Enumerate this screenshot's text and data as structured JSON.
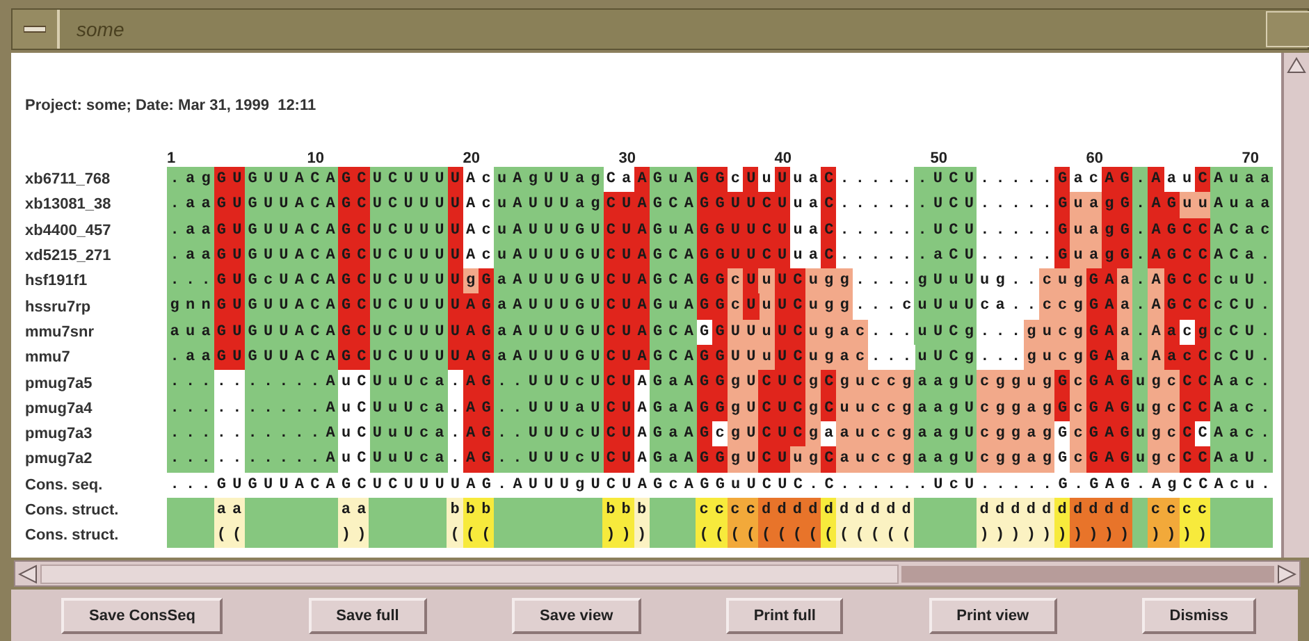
{
  "window": {
    "title": "some"
  },
  "header": "Project: some; Date: Mar 31, 1999  12:11",
  "ruler": [
    "1",
    "10",
    "20",
    "30",
    "40",
    "50",
    "60",
    "70"
  ],
  "rows": [
    {
      "name": "xb6711_768",
      "runs": [
        {
          "text": ".ag",
          "color": "#86c77f"
        },
        {
          "text": "GU",
          "color": "#e0251c"
        },
        {
          "text": "GUUACA",
          "color": "#86c77f"
        },
        {
          "text": "GC",
          "color": "#e0251c"
        },
        {
          "text": "UCUUU",
          "color": "#86c77f"
        },
        {
          "text": "U",
          "color": "#e0251c"
        },
        {
          "text": "Ac",
          "color": "#ffffff"
        },
        {
          "text": "uAgUUag",
          "color": "#86c77f"
        },
        {
          "text": "Ca",
          "color": "#ffffff"
        },
        {
          "text": "A",
          "color": "#e0251c"
        },
        {
          "text": "GuA",
          "color": "#86c77f"
        },
        {
          "text": "GG",
          "color": "#e0251c"
        },
        {
          "text": "c",
          "color": "#ffffff"
        },
        {
          "text": "U",
          "color": "#e0251c"
        },
        {
          "text": "u",
          "color": "#ffffff"
        },
        {
          "text": "U",
          "color": "#e0251c"
        },
        {
          "text": "ua",
          "color": "#ffffff"
        },
        {
          "text": "C",
          "color": "#e0251c"
        },
        {
          "text": ".....",
          "color": "#ffffff"
        },
        {
          "text": ".UCU",
          "color": "#86c77f"
        },
        {
          "text": ".....",
          "color": "#ffffff"
        },
        {
          "text": "G",
          "color": "#e0251c"
        },
        {
          "text": "ac",
          "color": "#ffffff"
        },
        {
          "text": "AG",
          "color": "#e0251c"
        },
        {
          "text": ".",
          "color": "#86c77f"
        },
        {
          "text": "A",
          "color": "#e0251c"
        },
        {
          "text": "au",
          "color": "#ffffff"
        },
        {
          "text": "C",
          "color": "#e0251c"
        },
        {
          "text": "Auaa",
          "color": "#86c77f"
        }
      ]
    },
    {
      "name": "xb13081_38",
      "runs": [
        {
          "text": ".aa",
          "color": "#86c77f"
        },
        {
          "text": "GU",
          "color": "#e0251c"
        },
        {
          "text": "GUUACA",
          "color": "#86c77f"
        },
        {
          "text": "GC",
          "color": "#e0251c"
        },
        {
          "text": "UCUUU",
          "color": "#86c77f"
        },
        {
          "text": "U",
          "color": "#e0251c"
        },
        {
          "text": "Ac",
          "color": "#ffffff"
        },
        {
          "text": "uAUUUag",
          "color": "#86c77f"
        },
        {
          "text": "CUA",
          "color": "#e0251c"
        },
        {
          "text": "GCA",
          "color": "#86c77f"
        },
        {
          "text": "GGUUCU",
          "color": "#e0251c"
        },
        {
          "text": "ua",
          "color": "#ffffff"
        },
        {
          "text": "C",
          "color": "#e0251c"
        },
        {
          "text": ".....",
          "color": "#ffffff"
        },
        {
          "text": ".UCU",
          "color": "#86c77f"
        },
        {
          "text": ".....",
          "color": "#ffffff"
        },
        {
          "text": "G",
          "color": "#e0251c"
        },
        {
          "text": "ua",
          "color": "#f2a98a"
        },
        {
          "text": "gG",
          "color": "#e0251c"
        },
        {
          "text": ".",
          "color": "#86c77f"
        },
        {
          "text": "AG",
          "color": "#e0251c"
        },
        {
          "text": "uu",
          "color": "#f2a98a"
        },
        {
          "text": "Auaa",
          "color": "#86c77f"
        }
      ]
    },
    {
      "name": "xb4400_457",
      "runs": [
        {
          "text": ".aa",
          "color": "#86c77f"
        },
        {
          "text": "GU",
          "color": "#e0251c"
        },
        {
          "text": "GUUACA",
          "color": "#86c77f"
        },
        {
          "text": "GC",
          "color": "#e0251c"
        },
        {
          "text": "UCUUU",
          "color": "#86c77f"
        },
        {
          "text": "U",
          "color": "#e0251c"
        },
        {
          "text": "Ac",
          "color": "#ffffff"
        },
        {
          "text": "uAUUUGU",
          "color": "#86c77f"
        },
        {
          "text": "CUA",
          "color": "#e0251c"
        },
        {
          "text": "GuA",
          "color": "#86c77f"
        },
        {
          "text": "GGUUCU",
          "color": "#e0251c"
        },
        {
          "text": "ua",
          "color": "#ffffff"
        },
        {
          "text": "C",
          "color": "#e0251c"
        },
        {
          "text": ".....",
          "color": "#ffffff"
        },
        {
          "text": ".UCU",
          "color": "#86c77f"
        },
        {
          "text": ".....",
          "color": "#ffffff"
        },
        {
          "text": "G",
          "color": "#e0251c"
        },
        {
          "text": "ua",
          "color": "#f2a98a"
        },
        {
          "text": "gG",
          "color": "#e0251c"
        },
        {
          "text": ".",
          "color": "#86c77f"
        },
        {
          "text": "AGCC",
          "color": "#e0251c"
        },
        {
          "text": "ACac",
          "color": "#86c77f"
        }
      ]
    },
    {
      "name": "xd5215_271",
      "runs": [
        {
          "text": ".aa",
          "color": "#86c77f"
        },
        {
          "text": "GU",
          "color": "#e0251c"
        },
        {
          "text": "GUUACA",
          "color": "#86c77f"
        },
        {
          "text": "GC",
          "color": "#e0251c"
        },
        {
          "text": "UCUUU",
          "color": "#86c77f"
        },
        {
          "text": "U",
          "color": "#e0251c"
        },
        {
          "text": "Ac",
          "color": "#ffffff"
        },
        {
          "text": "uAUUUGU",
          "color": "#86c77f"
        },
        {
          "text": "CUA",
          "color": "#e0251c"
        },
        {
          "text": "GCA",
          "color": "#86c77f"
        },
        {
          "text": "GGUUCU",
          "color": "#e0251c"
        },
        {
          "text": "ua",
          "color": "#ffffff"
        },
        {
          "text": "C",
          "color": "#e0251c"
        },
        {
          "text": ".....",
          "color": "#ffffff"
        },
        {
          "text": ".aCU",
          "color": "#86c77f"
        },
        {
          "text": ".....",
          "color": "#ffffff"
        },
        {
          "text": "G",
          "color": "#e0251c"
        },
        {
          "text": "ua",
          "color": "#f2a98a"
        },
        {
          "text": "gG",
          "color": "#e0251c"
        },
        {
          "text": ".",
          "color": "#86c77f"
        },
        {
          "text": "AGCC",
          "color": "#e0251c"
        },
        {
          "text": "ACa.",
          "color": "#86c77f"
        }
      ]
    },
    {
      "name": "hsf191f1",
      "runs": [
        {
          "text": "...",
          "color": "#86c77f"
        },
        {
          "text": "GU",
          "color": "#e0251c"
        },
        {
          "text": "GcUACA",
          "color": "#86c77f"
        },
        {
          "text": "GC",
          "color": "#e0251c"
        },
        {
          "text": "UCUUU",
          "color": "#86c77f"
        },
        {
          "text": "U",
          "color": "#e0251c"
        },
        {
          "text": "g",
          "color": "#f2a98a"
        },
        {
          "text": "G",
          "color": "#e0251c"
        },
        {
          "text": "aAUUUGU",
          "color": "#86c77f"
        },
        {
          "text": "CUA",
          "color": "#e0251c"
        },
        {
          "text": "GCA",
          "color": "#86c77f"
        },
        {
          "text": "GG",
          "color": "#e0251c"
        },
        {
          "text": "c",
          "color": "#f2a98a"
        },
        {
          "text": "U",
          "color": "#e0251c"
        },
        {
          "text": "u",
          "color": "#f2a98a"
        },
        {
          "text": "UC",
          "color": "#e0251c"
        },
        {
          "text": "ugg",
          "color": "#f2a98a"
        },
        {
          "text": "....",
          "color": "#ffffff"
        },
        {
          "text": "gUuU",
          "color": "#86c77f"
        },
        {
          "text": "ug..",
          "color": "#ffffff"
        },
        {
          "text": "cug",
          "color": "#f2a98a"
        },
        {
          "text": "GA",
          "color": "#e0251c"
        },
        {
          "text": "a",
          "color": "#f2a98a"
        },
        {
          "text": ".",
          "color": "#86c77f"
        },
        {
          "text": "A",
          "color": "#f2a98a"
        },
        {
          "text": "GCC",
          "color": "#e0251c"
        },
        {
          "text": "cuU.",
          "color": "#86c77f"
        }
      ]
    },
    {
      "name": "hssru7rp",
      "runs": [
        {
          "text": "gnn",
          "color": "#86c77f"
        },
        {
          "text": "GU",
          "color": "#e0251c"
        },
        {
          "text": "GUUACA",
          "color": "#86c77f"
        },
        {
          "text": "GC",
          "color": "#e0251c"
        },
        {
          "text": "UCUUU",
          "color": "#86c77f"
        },
        {
          "text": "UAG",
          "color": "#e0251c"
        },
        {
          "text": "aAUUUGU",
          "color": "#86c77f"
        },
        {
          "text": "CUA",
          "color": "#e0251c"
        },
        {
          "text": "GuA",
          "color": "#86c77f"
        },
        {
          "text": "GG",
          "color": "#e0251c"
        },
        {
          "text": "c",
          "color": "#f2a98a"
        },
        {
          "text": "U",
          "color": "#e0251c"
        },
        {
          "text": "u",
          "color": "#f2a98a"
        },
        {
          "text": "UC",
          "color": "#e0251c"
        },
        {
          "text": "ugg",
          "color": "#f2a98a"
        },
        {
          "text": "...c",
          "color": "#ffffff"
        },
        {
          "text": "uUuU",
          "color": "#86c77f"
        },
        {
          "text": "ca..",
          "color": "#ffffff"
        },
        {
          "text": "ccg",
          "color": "#f2a98a"
        },
        {
          "text": "GA",
          "color": "#e0251c"
        },
        {
          "text": "a",
          "color": "#f2a98a"
        },
        {
          "text": ".",
          "color": "#86c77f"
        },
        {
          "text": "A",
          "color": "#f2a98a"
        },
        {
          "text": "GCC",
          "color": "#e0251c"
        },
        {
          "text": "cCU.",
          "color": "#86c77f"
        }
      ]
    },
    {
      "name": "mmu7snr",
      "runs": [
        {
          "text": "aua",
          "color": "#86c77f"
        },
        {
          "text": "GU",
          "color": "#e0251c"
        },
        {
          "text": "GUUACA",
          "color": "#86c77f"
        },
        {
          "text": "GC",
          "color": "#e0251c"
        },
        {
          "text": "UCUUU",
          "color": "#86c77f"
        },
        {
          "text": "UAG",
          "color": "#e0251c"
        },
        {
          "text": "aAUUUGU",
          "color": "#86c77f"
        },
        {
          "text": "CUA",
          "color": "#e0251c"
        },
        {
          "text": "GCA",
          "color": "#86c77f"
        },
        {
          "text": "G",
          "color": "#ffffff"
        },
        {
          "text": "G",
          "color": "#e0251c"
        },
        {
          "text": "UUu",
          "color": "#f2a98a"
        },
        {
          "text": "UC",
          "color": "#e0251c"
        },
        {
          "text": "ugac",
          "color": "#f2a98a"
        },
        {
          "text": "...",
          "color": "#ffffff"
        },
        {
          "text": "uUCg",
          "color": "#86c77f"
        },
        {
          "text": "...",
          "color": "#ffffff"
        },
        {
          "text": "gucg",
          "color": "#f2a98a"
        },
        {
          "text": "GA",
          "color": "#e0251c"
        },
        {
          "text": "a",
          "color": "#f2a98a"
        },
        {
          "text": ".",
          "color": "#86c77f"
        },
        {
          "text": "A",
          "color": "#f2a98a"
        },
        {
          "text": "a",
          "color": "#e0251c"
        },
        {
          "text": "c",
          "color": "#ffffff"
        },
        {
          "text": "g",
          "color": "#e0251c"
        },
        {
          "text": "cCU.",
          "color": "#86c77f"
        }
      ]
    },
    {
      "name": "mmu7",
      "runs": [
        {
          "text": ".aa",
          "color": "#86c77f"
        },
        {
          "text": "GU",
          "color": "#e0251c"
        },
        {
          "text": "GUUACA",
          "color": "#86c77f"
        },
        {
          "text": "GC",
          "color": "#e0251c"
        },
        {
          "text": "UCUUU",
          "color": "#86c77f"
        },
        {
          "text": "UAG",
          "color": "#e0251c"
        },
        {
          "text": "aAUUUGU",
          "color": "#86c77f"
        },
        {
          "text": "CUA",
          "color": "#e0251c"
        },
        {
          "text": "GCA",
          "color": "#86c77f"
        },
        {
          "text": "GG",
          "color": "#e0251c"
        },
        {
          "text": "UUu",
          "color": "#f2a98a"
        },
        {
          "text": "UC",
          "color": "#e0251c"
        },
        {
          "text": "ugac",
          "color": "#f2a98a"
        },
        {
          "text": "...",
          "color": "#ffffff"
        },
        {
          "text": "uUCg",
          "color": "#86c77f"
        },
        {
          "text": "...",
          "color": "#ffffff"
        },
        {
          "text": "gucg",
          "color": "#f2a98a"
        },
        {
          "text": "GA",
          "color": "#e0251c"
        },
        {
          "text": "a",
          "color": "#f2a98a"
        },
        {
          "text": ".",
          "color": "#86c77f"
        },
        {
          "text": "A",
          "color": "#f2a98a"
        },
        {
          "text": "acC",
          "color": "#e0251c"
        },
        {
          "text": "cCU.",
          "color": "#86c77f"
        }
      ]
    },
    {
      "name": "pmug7a5",
      "runs": [
        {
          "text": "...",
          "color": "#86c77f"
        },
        {
          "text": "..",
          "color": "#ffffff"
        },
        {
          "text": ".....A",
          "color": "#86c77f"
        },
        {
          "text": "uC",
          "color": "#ffffff"
        },
        {
          "text": "UuUca",
          "color": "#86c77f"
        },
        {
          "text": ".",
          "color": "#ffffff"
        },
        {
          "text": "AG",
          "color": "#e0251c"
        },
        {
          "text": "..UUUcU",
          "color": "#86c77f"
        },
        {
          "text": "CU",
          "color": "#e0251c"
        },
        {
          "text": "A",
          "color": "#ffffff"
        },
        {
          "text": "GaA",
          "color": "#86c77f"
        },
        {
          "text": "GG",
          "color": "#e0251c"
        },
        {
          "text": "gU",
          "color": "#f2a98a"
        },
        {
          "text": "CUC",
          "color": "#e0251c"
        },
        {
          "text": "g",
          "color": "#f2a98a"
        },
        {
          "text": "C",
          "color": "#e0251c"
        },
        {
          "text": "guccg",
          "color": "#f2a98a"
        },
        {
          "text": "aagU",
          "color": "#86c77f"
        },
        {
          "text": "cggug",
          "color": "#f2a98a"
        },
        {
          "text": "G",
          "color": "#e0251c"
        },
        {
          "text": "c",
          "color": "#f2a98a"
        },
        {
          "text": "GAG",
          "color": "#e0251c"
        },
        {
          "text": "u",
          "color": "#86c77f"
        },
        {
          "text": "gc",
          "color": "#f2a98a"
        },
        {
          "text": "CC",
          "color": "#e0251c"
        },
        {
          "text": "Aac.",
          "color": "#86c77f"
        }
      ]
    },
    {
      "name": "pmug7a4",
      "runs": [
        {
          "text": "...",
          "color": "#86c77f"
        },
        {
          "text": "..",
          "color": "#ffffff"
        },
        {
          "text": ".....A",
          "color": "#86c77f"
        },
        {
          "text": "uC",
          "color": "#ffffff"
        },
        {
          "text": "UuUca",
          "color": "#86c77f"
        },
        {
          "text": ".",
          "color": "#ffffff"
        },
        {
          "text": "AG",
          "color": "#e0251c"
        },
        {
          "text": "..UUUaU",
          "color": "#86c77f"
        },
        {
          "text": "CU",
          "color": "#e0251c"
        },
        {
          "text": "A",
          "color": "#ffffff"
        },
        {
          "text": "GaA",
          "color": "#86c77f"
        },
        {
          "text": "GG",
          "color": "#e0251c"
        },
        {
          "text": "gU",
          "color": "#f2a98a"
        },
        {
          "text": "CUC",
          "color": "#e0251c"
        },
        {
          "text": "g",
          "color": "#f2a98a"
        },
        {
          "text": "C",
          "color": "#e0251c"
        },
        {
          "text": "uuccg",
          "color": "#f2a98a"
        },
        {
          "text": "aagU",
          "color": "#86c77f"
        },
        {
          "text": "cggag",
          "color": "#f2a98a"
        },
        {
          "text": "G",
          "color": "#e0251c"
        },
        {
          "text": "c",
          "color": "#f2a98a"
        },
        {
          "text": "GAG",
          "color": "#e0251c"
        },
        {
          "text": "u",
          "color": "#86c77f"
        },
        {
          "text": "gc",
          "color": "#f2a98a"
        },
        {
          "text": "CC",
          "color": "#e0251c"
        },
        {
          "text": "Aac.",
          "color": "#86c77f"
        }
      ]
    },
    {
      "name": "pmug7a3",
      "runs": [
        {
          "text": "...",
          "color": "#86c77f"
        },
        {
          "text": "..",
          "color": "#ffffff"
        },
        {
          "text": ".....A",
          "color": "#86c77f"
        },
        {
          "text": "uC",
          "color": "#ffffff"
        },
        {
          "text": "UuUca",
          "color": "#86c77f"
        },
        {
          "text": ".",
          "color": "#ffffff"
        },
        {
          "text": "AG",
          "color": "#e0251c"
        },
        {
          "text": "..UUUcU",
          "color": "#86c77f"
        },
        {
          "text": "CU",
          "color": "#e0251c"
        },
        {
          "text": "A",
          "color": "#ffffff"
        },
        {
          "text": "GaA",
          "color": "#86c77f"
        },
        {
          "text": "G",
          "color": "#e0251c"
        },
        {
          "text": "c",
          "color": "#ffffff"
        },
        {
          "text": "gU",
          "color": "#f2a98a"
        },
        {
          "text": "CUC",
          "color": "#e0251c"
        },
        {
          "text": "g",
          "color": "#f2a98a"
        },
        {
          "text": "a",
          "color": "#ffffff"
        },
        {
          "text": "auccg",
          "color": "#f2a98a"
        },
        {
          "text": "aagU",
          "color": "#86c77f"
        },
        {
          "text": "cggag",
          "color": "#f2a98a"
        },
        {
          "text": "G",
          "color": "#ffffff"
        },
        {
          "text": "c",
          "color": "#f2a98a"
        },
        {
          "text": "GAG",
          "color": "#e0251c"
        },
        {
          "text": "u",
          "color": "#86c77f"
        },
        {
          "text": "gc",
          "color": "#f2a98a"
        },
        {
          "text": "C",
          "color": "#e0251c"
        },
        {
          "text": "C",
          "color": "#ffffff"
        },
        {
          "text": "Aac.",
          "color": "#86c77f"
        }
      ]
    },
    {
      "name": "pmug7a2",
      "runs": [
        {
          "text": "...",
          "color": "#86c77f"
        },
        {
          "text": "..",
          "color": "#ffffff"
        },
        {
          "text": ".....A",
          "color": "#86c77f"
        },
        {
          "text": "uC",
          "color": "#ffffff"
        },
        {
          "text": "UuUca",
          "color": "#86c77f"
        },
        {
          "text": ".",
          "color": "#ffffff"
        },
        {
          "text": "AG",
          "color": "#e0251c"
        },
        {
          "text": "..UUUcU",
          "color": "#86c77f"
        },
        {
          "text": "CU",
          "color": "#e0251c"
        },
        {
          "text": "A",
          "color": "#ffffff"
        },
        {
          "text": "GaA",
          "color": "#86c77f"
        },
        {
          "text": "GG",
          "color": "#e0251c"
        },
        {
          "text": "gU",
          "color": "#f2a98a"
        },
        {
          "text": "CU",
          "color": "#e0251c"
        },
        {
          "text": "ug",
          "color": "#f2a98a"
        },
        {
          "text": "C",
          "color": "#e0251c"
        },
        {
          "text": "auccg",
          "color": "#f2a98a"
        },
        {
          "text": "aagU",
          "color": "#86c77f"
        },
        {
          "text": "cggag",
          "color": "#f2a98a"
        },
        {
          "text": "G",
          "color": "#ffffff"
        },
        {
          "text": "c",
          "color": "#f2a98a"
        },
        {
          "text": "GAG",
          "color": "#e0251c"
        },
        {
          "text": "u",
          "color": "#86c77f"
        },
        {
          "text": "gc",
          "color": "#f2a98a"
        },
        {
          "text": "CC",
          "color": "#e0251c"
        },
        {
          "text": "AaU.",
          "color": "#86c77f"
        }
      ]
    },
    {
      "name": "Cons. seq.",
      "runs": [
        {
          "text": "...GUGUUACAGCUCUUUUAG.AUUUgUCUAGcAGGuUCUC.C......UcU.....G.GAG.AgCCAcu.",
          "color": "#ffffff"
        }
      ]
    },
    {
      "name": "Cons. struct.",
      "runs": [
        {
          "color": "#86c77f"
        },
        {
          "color": "#86c77f"
        },
        {
          "color": "#86c77f"
        },
        {
          "text": "aa",
          "color": "#fbf2c2"
        },
        {
          "color": "#86c77f"
        },
        {
          "color": "#86c77f"
        },
        {
          "color": "#86c77f"
        },
        {
          "color": "#86c77f"
        },
        {
          "color": "#86c77f"
        },
        {
          "color": "#86c77f"
        },
        {
          "text": "aa",
          "color": "#fbf2c2"
        },
        {
          "color": "#86c77f"
        },
        {
          "color": "#86c77f"
        },
        {
          "color": "#86c77f"
        },
        {
          "color": "#86c77f"
        },
        {
          "color": "#86c77f"
        },
        {
          "text": "b",
          "color": "#fbf2c2"
        },
        {
          "text": "bb",
          "color": "#f7ea3c"
        },
        {
          "color": "#86c77f"
        },
        {
          "color": "#86c77f"
        },
        {
          "color": "#86c77f"
        },
        {
          "color": "#86c77f"
        },
        {
          "color": "#86c77f"
        },
        {
          "color": "#86c77f"
        },
        {
          "color": "#86c77f"
        },
        {
          "text": "bb",
          "color": "#f7ea3c"
        },
        {
          "text": "b",
          "color": "#fbf2c2"
        },
        {
          "color": "#86c77f"
        },
        {
          "color": "#86c77f"
        },
        {
          "color": "#86c77f"
        },
        {
          "text": "cc",
          "color": "#f7ea3c"
        },
        {
          "text": "cc",
          "color": "#f2a93a"
        },
        {
          "text": "dddd",
          "color": "#e8742a"
        },
        {
          "text": "d",
          "color": "#f7ea3c"
        },
        {
          "text": "ddddd",
          "color": "#fbf2c2"
        },
        {
          "color": "#86c77f"
        },
        {
          "color": "#86c77f"
        },
        {
          "color": "#86c77f"
        },
        {
          "color": "#86c77f"
        },
        {
          "text": "ddddd",
          "color": "#fbf2c2"
        },
        {
          "text": "d",
          "color": "#f7ea3c"
        },
        {
          "text": "dddd",
          "color": "#e8742a"
        },
        {
          "color": "#86c77f"
        },
        {
          "text": "cc",
          "color": "#f2a93a"
        },
        {
          "text": "cc",
          "color": "#f7ea3c"
        },
        {
          "color": "#86c77f"
        },
        {
          "color": "#86c77f"
        },
        {
          "color": "#86c77f"
        },
        {
          "color": "#86c77f"
        }
      ]
    },
    {
      "name": "Cons. struct.",
      "runs": [
        {
          "color": "#86c77f"
        },
        {
          "color": "#86c77f"
        },
        {
          "color": "#86c77f"
        },
        {
          "text": "((",
          "color": "#fbf2c2"
        },
        {
          "color": "#86c77f"
        },
        {
          "color": "#86c77f"
        },
        {
          "color": "#86c77f"
        },
        {
          "color": "#86c77f"
        },
        {
          "color": "#86c77f"
        },
        {
          "color": "#86c77f"
        },
        {
          "text": "))",
          "color": "#fbf2c2"
        },
        {
          "color": "#86c77f"
        },
        {
          "color": "#86c77f"
        },
        {
          "color": "#86c77f"
        },
        {
          "color": "#86c77f"
        },
        {
          "color": "#86c77f"
        },
        {
          "text": "(",
          "color": "#fbf2c2"
        },
        {
          "text": "((",
          "color": "#f7ea3c"
        },
        {
          "color": "#86c77f"
        },
        {
          "color": "#86c77f"
        },
        {
          "color": "#86c77f"
        },
        {
          "color": "#86c77f"
        },
        {
          "color": "#86c77f"
        },
        {
          "color": "#86c77f"
        },
        {
          "color": "#86c77f"
        },
        {
          "text": "))",
          "color": "#f7ea3c"
        },
        {
          "text": ")",
          "color": "#fbf2c2"
        },
        {
          "color": "#86c77f"
        },
        {
          "color": "#86c77f"
        },
        {
          "color": "#86c77f"
        },
        {
          "text": "((",
          "color": "#f7ea3c"
        },
        {
          "text": "((",
          "color": "#f2a93a"
        },
        {
          "text": "((((",
          "color": "#e8742a"
        },
        {
          "text": "(",
          "color": "#f7ea3c"
        },
        {
          "text": "(((((",
          "color": "#fbf2c2"
        },
        {
          "color": "#86c77f"
        },
        {
          "color": "#86c77f"
        },
        {
          "color": "#86c77f"
        },
        {
          "color": "#86c77f"
        },
        {
          "text": ")))))",
          "color": "#fbf2c2"
        },
        {
          "text": ")",
          "color": "#f7ea3c"
        },
        {
          "text": "))))",
          "color": "#e8742a"
        },
        {
          "color": "#86c77f"
        },
        {
          "text": "))",
          "color": "#f2a93a"
        },
        {
          "text": "))",
          "color": "#f7ea3c"
        },
        {
          "color": "#86c77f"
        },
        {
          "color": "#86c77f"
        },
        {
          "color": "#86c77f"
        },
        {
          "color": "#86c77f"
        }
      ]
    }
  ],
  "buttons": [
    "Save ConsSeq",
    "Save full",
    "Save view",
    "Print full",
    "Print view",
    "Dismiss"
  ]
}
